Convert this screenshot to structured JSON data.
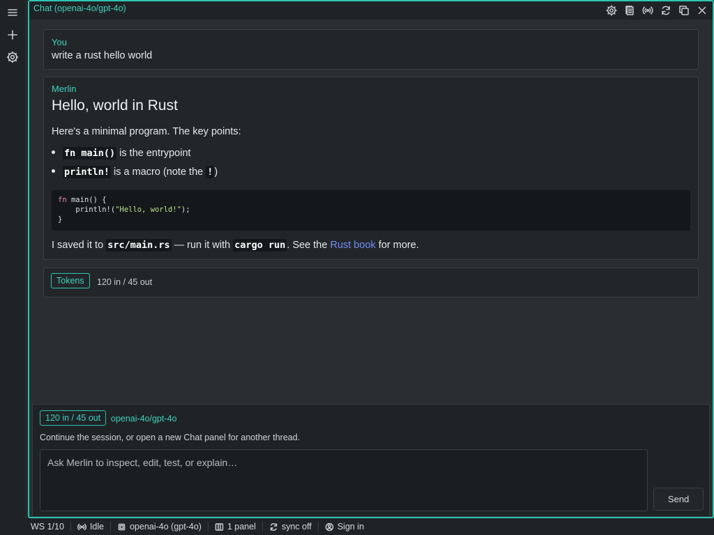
{
  "panel": {
    "title": "Chat (openai-4o/gpt-4o)"
  },
  "user_message": {
    "author": "You",
    "text": "write a rust hello world"
  },
  "assistant_message": {
    "author": "Merlin",
    "heading": "Hello, world in Rust",
    "intro": "Here's a minimal program. The key points:",
    "bullets": [
      {
        "code": "fn main()",
        "text": " is the entrypoint"
      },
      {
        "code": "println!",
        "text_before": " is a macro (note the ",
        "code2": "!",
        "text_after": ")"
      }
    ],
    "code_lines": [
      "fn main() {",
      "    println!(\"Hello, world!\");",
      "}"
    ],
    "outro": {
      "t1": "I saved it to ",
      "c1": "src/main.rs",
      "t2": " — run it with ",
      "c2": "cargo run",
      "t3": ". See the ",
      "link": "Rust book",
      "t4": " for more."
    }
  },
  "tokens_card": {
    "badge": "Tokens",
    "value": "120 in / 45 out"
  },
  "composer": {
    "token_badge": "120 in / 45 out",
    "model": "openai-4o/gpt-4o",
    "hint": "Continue the session, or open a new Chat panel for another thread.",
    "placeholder": "Ask Merlin to inspect, edit, test, or explain…",
    "send_label": "Send"
  },
  "status_bar": {
    "workspace": "WS 1/10",
    "state": "Idle",
    "model": "openai-4o (gpt-4o)",
    "panels": "1 panel",
    "sync": "sync off",
    "sign_in": "Sign in"
  },
  "colors": {
    "accent": "#2ec4b0",
    "link": "#6f8ff5",
    "background": "#2a2e31"
  }
}
